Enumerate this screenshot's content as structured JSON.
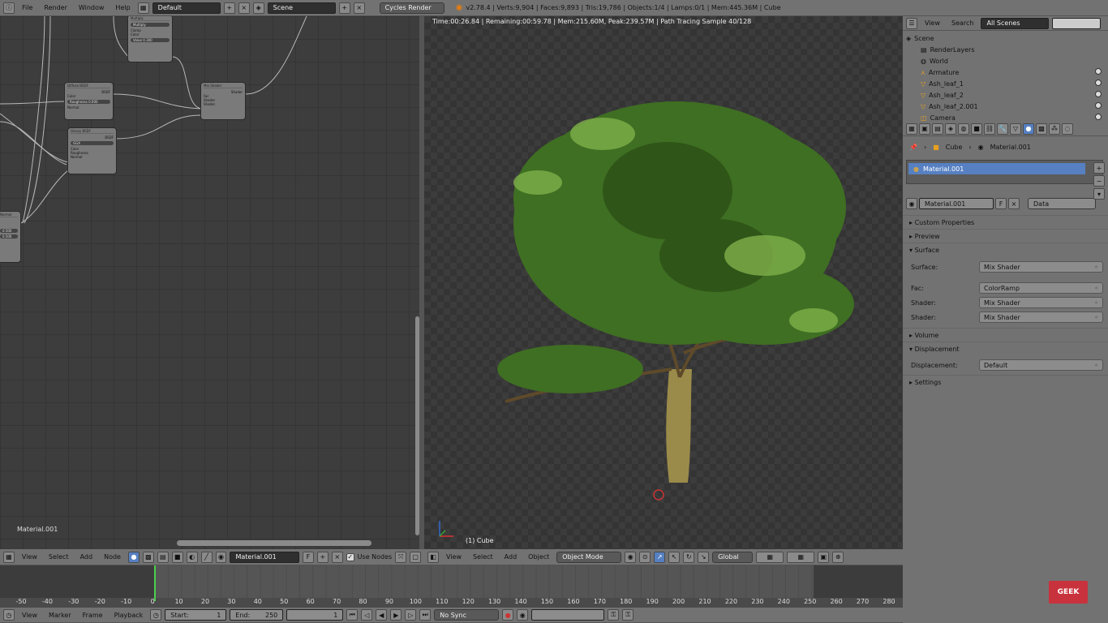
{
  "top_menu": {
    "items": [
      "File",
      "Render",
      "Window",
      "Help"
    ],
    "layout": "Default",
    "scene": "Scene",
    "engine": "Cycles Render",
    "stats": "v2.78.4 | Verts:9,904 | Faces:9,893 | Tris:19,786 | Objects:1/4 | Lamps:0/1 | Mem:445.36M | Cube"
  },
  "node_editor": {
    "material_label": "Material.001",
    "nodes": [
      {
        "title": "Multiply",
        "fields": [
          "Multiply",
          "Clamp",
          "Color",
          "Value 0.300"
        ]
      },
      {
        "title": "Diffuse BSDF",
        "fields": [
          "BSDF",
          "Color",
          "Roughness 0.000",
          "Normal"
        ]
      },
      {
        "title": "Mix Shader",
        "fields": [
          "Shader",
          "Fac",
          "Shader",
          "Shader"
        ]
      },
      {
        "title": "Glossy BSDF",
        "fields": [
          "BSDF",
          "GGX",
          "Color",
          "Roughness",
          "Normal"
        ]
      },
      {
        "title": "Normal",
        "fields": [
          "0.500",
          "0.500"
        ]
      }
    ],
    "header": {
      "menus": [
        "View",
        "Select",
        "Add",
        "Node"
      ],
      "material": "Material.001",
      "use_nodes": "Use Nodes"
    }
  },
  "viewport": {
    "info": "Time:00:26.84 | Remaining:00:59.78 | Mem:215.60M, Peak:239.57M | Path Tracing Sample 40/128",
    "object_label": "(1) Cube",
    "header": {
      "menus": [
        "View",
        "Select",
        "Add",
        "Object"
      ],
      "mode": "Object Mode",
      "orientation": "Global"
    }
  },
  "outliner": {
    "view": "View",
    "search": "Search",
    "filter": "All Scenes",
    "items": [
      "Scene",
      "RenderLayers",
      "World",
      "Armature",
      "Ash_leaf_1",
      "Ash_leaf_2",
      "Ash_leaf_2.001",
      "Camera"
    ]
  },
  "properties": {
    "breadcrumb": [
      "Cube",
      "Material.001"
    ],
    "slot": "Material.001",
    "material_name": "Material.001",
    "f_label": "F",
    "link": "Data",
    "panels_top": [
      "Custom Properties",
      "Preview"
    ],
    "surface_panel": "Surface",
    "surface_rows": [
      {
        "label": "Surface:",
        "value": "Mix Shader"
      },
      {
        "label": "Fac:",
        "value": "ColorRamp"
      },
      {
        "label": "Shader:",
        "value": "Mix Shader"
      },
      {
        "label": "Shader:",
        "value": "Mix Shader"
      }
    ],
    "volume_panel": "Volume",
    "displacement_panel": "Displacement",
    "displacement_row": {
      "label": "Displacement:",
      "value": "Default"
    },
    "settings_panel": "Settings"
  },
  "timeline": {
    "ticks": [
      "-50",
      "-40",
      "-30",
      "-20",
      "-10",
      "0",
      "10",
      "20",
      "30",
      "40",
      "50",
      "60",
      "70",
      "80",
      "90",
      "100",
      "110",
      "120",
      "130",
      "140",
      "150",
      "160",
      "170",
      "180",
      "190",
      "200",
      "210",
      "220",
      "230",
      "240",
      "250",
      "260",
      "270",
      "280"
    ],
    "menus": [
      "View",
      "Marker",
      "Frame",
      "Playback"
    ],
    "start": "Start:",
    "start_val": "1",
    "end": "End:",
    "end_val": "250",
    "current": "1",
    "sync": "No Sync"
  },
  "watermark": "GEEK",
  "colors": {
    "accent": "#5680c2",
    "header": "#727272",
    "green_marker": "#4bd14b"
  }
}
